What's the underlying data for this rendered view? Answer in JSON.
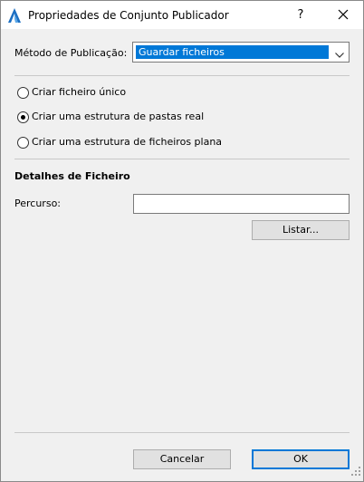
{
  "window": {
    "title": "Propriedades de Conjunto Publicador",
    "help_label": "?"
  },
  "publish_method": {
    "label": "Método de Publicação:",
    "selected": "Guardar ficheiros"
  },
  "options": [
    {
      "label": "Criar ficheiro único",
      "checked": false
    },
    {
      "label": "Criar uma estrutura de pastas real",
      "checked": true
    },
    {
      "label": "Criar uma estrutura de ficheiros plana",
      "checked": false
    }
  ],
  "file_details": {
    "heading": "Detalhes de Ficheiro",
    "path_label": "Percurso:",
    "path_value": "",
    "browse_label": "Listar..."
  },
  "footer": {
    "cancel_label": "Cancelar",
    "ok_label": "OK"
  },
  "colors": {
    "accent": "#0078d7",
    "dialog_bg": "#f0f0f0"
  },
  "icons": [
    "archicad-icon",
    "close-icon",
    "chevron-down-icon",
    "resize-grip-icon"
  ]
}
